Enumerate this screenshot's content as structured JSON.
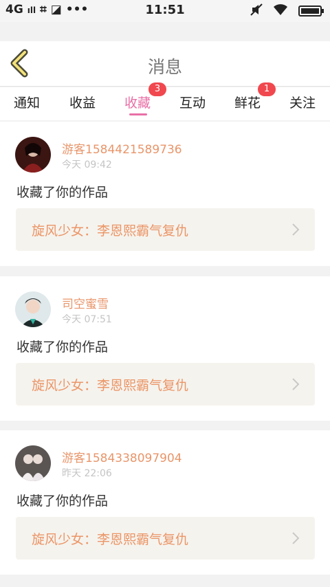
{
  "status_bar": {
    "left_items": [
      "4G",
      "ıll",
      "⌗",
      "◪",
      "•••"
    ],
    "time": "11:51"
  },
  "header": {
    "title": "消息"
  },
  "tabs": [
    {
      "label": "通知",
      "badge": ""
    },
    {
      "label": "收益",
      "badge": ""
    },
    {
      "label": "收藏",
      "badge": "3"
    },
    {
      "label": "互动",
      "badge": ""
    },
    {
      "label": "鲜花",
      "badge": "1"
    },
    {
      "label": "关注",
      "badge": ""
    }
  ],
  "active_tab": "收藏",
  "colors": {
    "accent_pink": "#e86fa6",
    "name_orange": "#e8956a",
    "badge_red": "#f0484e",
    "work_bg": "#f5f3ee"
  },
  "messages": [
    {
      "user": "游客1584421589736",
      "time": "今天 09:42",
      "action": "收藏了你的作品",
      "work": "旋风少女：李恩熙霸气复仇"
    },
    {
      "user": "司空蜜雪",
      "time": "今天 07:51",
      "action": "收藏了你的作品",
      "work": "旋风少女：李恩熙霸气复仇"
    },
    {
      "user": "游客1584338097904",
      "time": "昨天 22:06",
      "action": "收藏了你的作品",
      "work": "旋风少女：李恩熙霸气复仇"
    }
  ]
}
